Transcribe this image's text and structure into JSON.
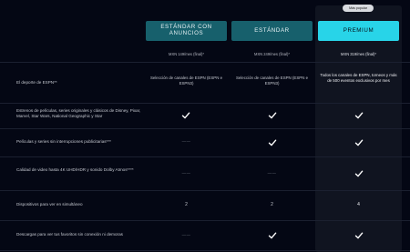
{
  "badge": "Más popular",
  "plans": [
    {
      "name": "ESTÁNDAR CON ANUNCIOS",
      "price": "MXN 149/mes (final)*"
    },
    {
      "name": "ESTÁNDAR",
      "price": "MXN 249/mes (final)*"
    },
    {
      "name": "PREMIUM",
      "price": "MXN 319/mes (final)*"
    }
  ],
  "rows": [
    {
      "label": "El deporte de ESPN**",
      "values": [
        "Selección de canales de ESPN (ESPN e ESPN3)",
        "Selección de canales de ESPN (ESPN e ESPN3)",
        "Todos los canales de ESPN, torneos y más de 500 eventos exclusivos por mes"
      ]
    },
    {
      "label": "Estrenos de películas, series originales y clásicos de Disney, Pixar, Marvel, Star Wars, National Geographic y Star",
      "values": [
        "check",
        "check",
        "check"
      ]
    },
    {
      "label": "Películas y series sin interrupciones publicitarias***",
      "values": [
        "dash",
        "check",
        "check"
      ]
    },
    {
      "label": "Calidad de video hasta 4K UHD/HDR y sonido Dolby Atmos****",
      "values": [
        "dash",
        "dash",
        "check"
      ]
    },
    {
      "label": "Dispositivos para ver en simultáneo",
      "values": [
        "2",
        "2",
        "4"
      ]
    },
    {
      "label": "Descargas para ver tus favoritos sin conexión ni demoras",
      "values": [
        "dash",
        "check",
        "check"
      ]
    }
  ],
  "symbols": {
    "dash": "——"
  },
  "icons": {
    "check": "check-icon"
  },
  "colors": {
    "background": "#040714",
    "premium_accent": "#28d4e8",
    "standard_button": "#17606c"
  }
}
